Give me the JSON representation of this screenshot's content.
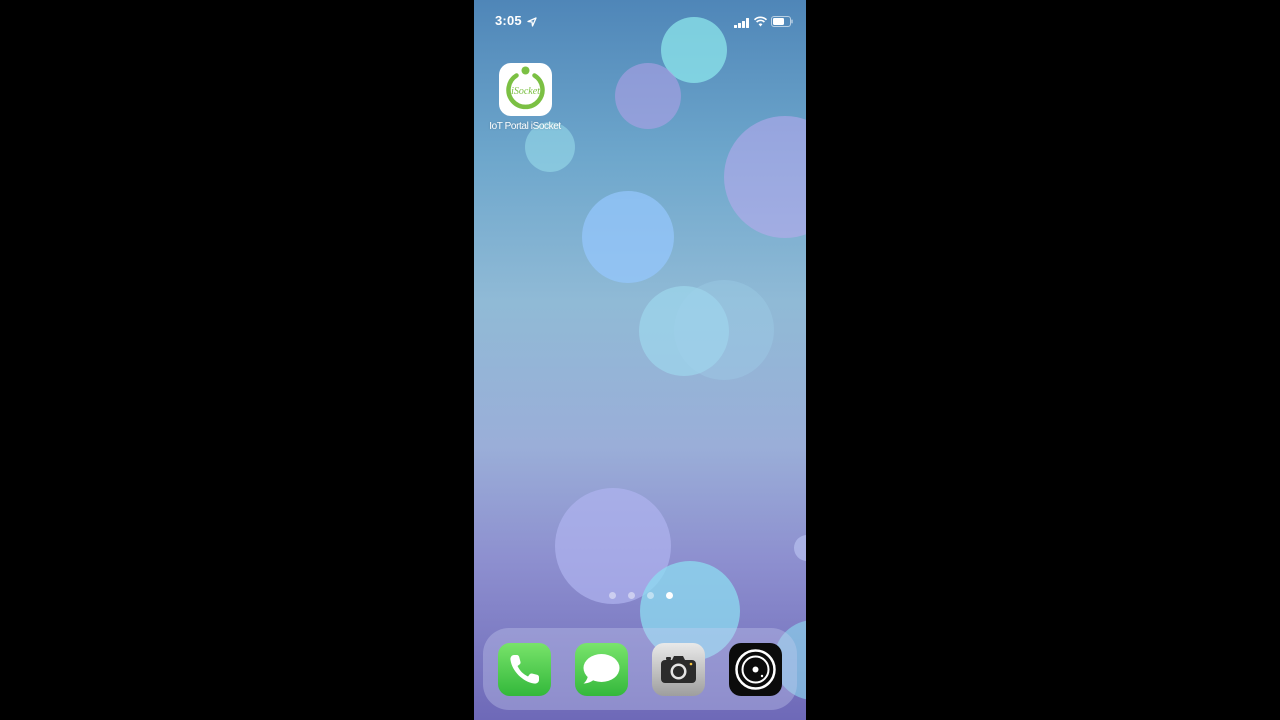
{
  "status_bar": {
    "time": "3:05",
    "icons": [
      "location-arrow-icon",
      "cellular-signal-icon",
      "wifi-icon",
      "battery-icon"
    ]
  },
  "home_screen": {
    "apps": [
      {
        "label": "IoT Portal iSocket",
        "icon_text": "iSocket",
        "icon": "isocket-power-icon",
        "accent": "#7bc043"
      }
    ],
    "page_count": 4,
    "active_page": 4
  },
  "dock": {
    "apps": [
      {
        "icon": "phone-icon",
        "color": "#4cd964"
      },
      {
        "icon": "messages-icon",
        "color": "#4cd964"
      },
      {
        "icon": "camera-icon",
        "color": "#b0b0b0"
      },
      {
        "icon": "watch-app-icon",
        "color": "#000000"
      }
    ]
  }
}
